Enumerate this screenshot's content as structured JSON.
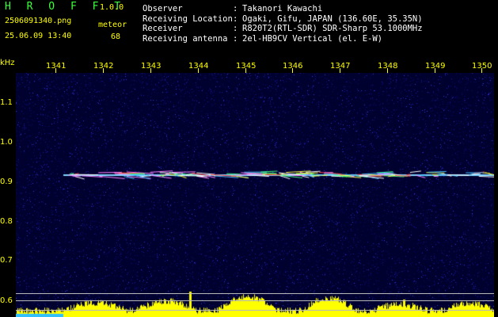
{
  "header": {
    "app_title": "H R O F F T",
    "version": "1.0.0",
    "filename": "2506091340.png",
    "datetime": "25.06.09 13:40",
    "meteor_label": "meteor",
    "meteor_count": "68",
    "info": [
      {
        "key": "Observer",
        "sep": ":",
        "value": "Takanori Kawachi"
      },
      {
        "key": "Receiving Location",
        "sep": ":",
        "value": "Ogaki, Gifu, JAPAN (136.60E, 35.35N)"
      },
      {
        "key": "Receiver",
        "sep": ":",
        "value": "R820T2(RTL-SDR) SDR-Sharp 53.1000MHz"
      },
      {
        "key": "Receiving antenna",
        "sep": ":",
        "value": "2el-HB9CV Vertical (el. E-W)"
      }
    ]
  },
  "axes": {
    "y_unit": "kHz",
    "x_ticks": [
      "1341",
      "1342",
      "1343",
      "1344",
      "1345",
      "1346",
      "1347",
      "1348",
      "1349",
      "1350"
    ],
    "y_ticks": [
      "1.1",
      "1.0",
      "0.9",
      "0.8",
      "0.7",
      "0.6"
    ]
  },
  "colors": {
    "title": "#3cff3c",
    "label": "#ffff00",
    "background": "#010130",
    "signal_bars": "#ffff00"
  }
}
